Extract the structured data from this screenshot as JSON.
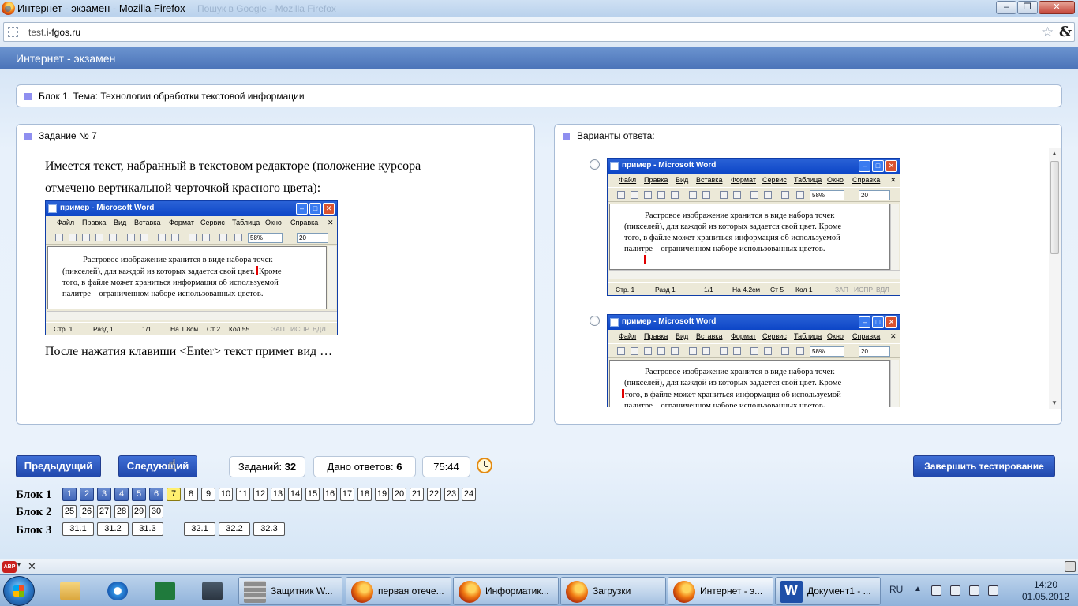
{
  "window": {
    "title": "Интернет - экзамен - Mozilla Firefox",
    "ghost_title": "Пошук в Google - Mozilla Firefox",
    "min": "‒",
    "max": "❐",
    "close": "✕"
  },
  "urlbar": {
    "prefix": "test.",
    "domain": "i-fgos.ru"
  },
  "page": {
    "header": "Интернет - экзамен",
    "block_title": "Блок 1. Тема: Технологии обработки текстовой информации",
    "task_title": "Задание № 7",
    "question_line1": "Имеется текст, набранный в текстовом редакторе (положение курсора",
    "question_line2": "отмечено вертикальной черточкой красного цвета):",
    "question_after": "После нажатия клавиши <Enter> текст примет вид …",
    "answers_title": "Варианты ответа:"
  },
  "word": {
    "title": "пример - Microsoft Word",
    "menu": [
      "Файл",
      "Правка",
      "Вид",
      "Вставка",
      "Формат",
      "Сервис",
      "Таблица",
      "Окно",
      "Справка"
    ],
    "zoom": "58%",
    "font_size": "20",
    "question_doc": {
      "line1": "Растровое изображение хранится в виде набора точек",
      "line2a": "(пикселей), для каждой из которых задается свой цвет.",
      "line2b": "Кроме",
      "line3": "того, в файле может храниться информация об используемой",
      "line4": "палитре – ограниченном наборе использованных цветов.",
      "status": {
        "page": "Стр. 1",
        "section": "Разд 1",
        "pages": "1/1",
        "at": "На 1.8см",
        "line": "Ст 2",
        "col": "Кол 55",
        "rec": "ЗАП",
        "trk": "ИСПР",
        "ext": "ВДЛ"
      }
    },
    "answer1_doc": {
      "line1": "Растровое изображение хранится в виде набора точек",
      "line2": "(пикселей), для каждой из которых задается свой цвет. Кроме",
      "line3": "того, в файле может храниться информация об используемой",
      "line4": "палитре – ограниченном наборе использованных цветов.",
      "status": {
        "page": "Стр. 1",
        "section": "Разд 1",
        "pages": "1/1",
        "at": "На 4.2см",
        "line": "Ст 5",
        "col": "Кол 1",
        "rec": "ЗАП",
        "trk": "ИСПР",
        "ext": "ВДЛ"
      }
    },
    "answer2_doc": {
      "line1": "Растровое изображение хранится в виде набора точек",
      "line2": "(пикселей), для каждой из которых задается свой цвет. Кроме",
      "line3": "того, в файле может храниться информация об используемой",
      "line4": "палитре – ограниченном наборе использованных цветов."
    }
  },
  "controls": {
    "prev": "Предыдущий",
    "next": "Следующий",
    "tasks_label": "Заданий:",
    "tasks_count": "32",
    "answered_label": "Дано ответов:",
    "answered_count": "6",
    "timer": "75:44",
    "finish": "Завершить тестирование"
  },
  "question_nav": {
    "block1_label": "Блок 1",
    "block2_label": "Блок 2",
    "block3_label": "Блок 3",
    "block1": [
      "1",
      "2",
      "3",
      "4",
      "5",
      "6",
      "7",
      "8",
      "9",
      "10",
      "11",
      "12",
      "13",
      "14",
      "15",
      "16",
      "17",
      "18",
      "19",
      "20",
      "21",
      "22",
      "23",
      "24"
    ],
    "block1_answered": 6,
    "block1_current": "7",
    "block2": [
      "25",
      "26",
      "27",
      "28",
      "29",
      "30"
    ],
    "block3a": [
      "31.1",
      "31.2",
      "31.3"
    ],
    "block3b": [
      "32.1",
      "32.2",
      "32.3"
    ]
  },
  "addonbar": {
    "abp": "ABP",
    "close": "✕"
  },
  "taskbar": {
    "tasks": [
      "Защитник W...",
      "первая отече...",
      "Информатик...",
      "Загрузки",
      "Интернет - э...",
      "Документ1 - ..."
    ],
    "lang": "RU",
    "time": "14:20",
    "date": "01.05.2012"
  },
  "colors": {
    "header": "#4a73b8",
    "button": "#2148ad",
    "current_question": "#ffef70",
    "cursor": "#e00000"
  }
}
